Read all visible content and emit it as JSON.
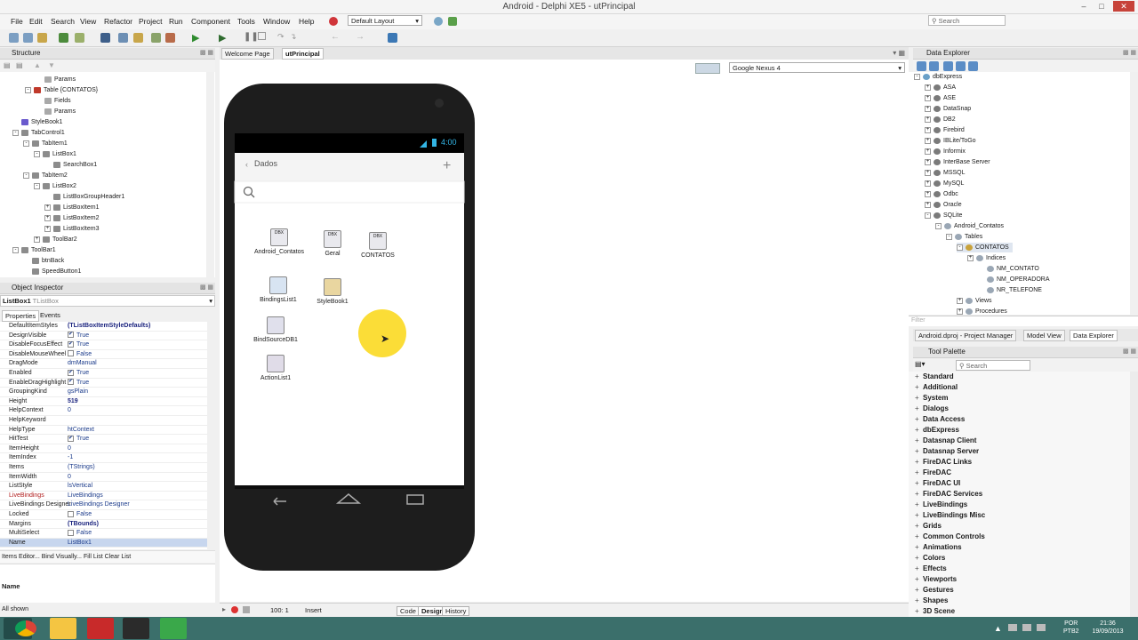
{
  "window": {
    "title": "Android - Delphi XE5 - utPrincipal",
    "search_placeholder": "Search"
  },
  "menu": [
    "File",
    "Edit",
    "Search",
    "View",
    "Refactor",
    "Project",
    "Run",
    "Component",
    "Tools",
    "Window",
    "Help"
  ],
  "layout_select": "Default Layout",
  "structure": {
    "title": "Structure",
    "rows": [
      "Params",
      "Table {CONTATOS}",
      "Fields",
      "Params",
      "StyleBook1",
      "TabControl1",
      "TabItem1",
      "ListBox1",
      "SearchBox1",
      "TabItem2",
      "ListBox2",
      "ListBoxGroupHeader1",
      "ListBoxItem1",
      "ListBoxItem2",
      "ListBoxItem3",
      "ToolBar2",
      "ToolBar1",
      "btnBack",
      "SpeedButton1"
    ]
  },
  "object_inspector": {
    "title": "Object Inspector",
    "selected": "ListBox1",
    "selected_type": "TListBox",
    "tabs": [
      "Properties",
      "Events"
    ],
    "props": [
      {
        "n": "DefaultItemStyles",
        "v": "(TListBoxItemStyleDefaults)",
        "bold": true
      },
      {
        "n": "DesignVisible",
        "v": "True",
        "chk": true
      },
      {
        "n": "DisableFocusEffect",
        "v": "True",
        "chk": true
      },
      {
        "n": "DisableMouseWheel",
        "v": "False",
        "chk": false
      },
      {
        "n": "DragMode",
        "v": "dmManual"
      },
      {
        "n": "Enabled",
        "v": "True",
        "chk": true
      },
      {
        "n": "EnableDragHighlight",
        "v": "True",
        "chk": true
      },
      {
        "n": "GroupingKind",
        "v": "gsPlain"
      },
      {
        "n": "Height",
        "v": "519",
        "bold": true
      },
      {
        "n": "HelpContext",
        "v": "0"
      },
      {
        "n": "HelpKeyword",
        "v": ""
      },
      {
        "n": "HelpType",
        "v": "htContext"
      },
      {
        "n": "HitTest",
        "v": "True",
        "chk": true
      },
      {
        "n": "ItemHeight",
        "v": "0"
      },
      {
        "n": "ItemIndex",
        "v": "-1"
      },
      {
        "n": "Items",
        "v": "(TStrings)"
      },
      {
        "n": "ItemWidth",
        "v": "0"
      },
      {
        "n": "ListStyle",
        "v": "lsVertical"
      },
      {
        "n": "LiveBindings",
        "v": "LiveBindings",
        "red": true
      },
      {
        "n": "LiveBindings Designer",
        "v": "LiveBindings Designer"
      },
      {
        "n": "Locked",
        "v": "False",
        "chk": false
      },
      {
        "n": "Margins",
        "v": "(TBounds)",
        "bold": true
      },
      {
        "n": "MultiSelect",
        "v": "False",
        "chk": false
      },
      {
        "n": "Name",
        "v": "ListBox1"
      }
    ],
    "footer_links": "Items Editor... Bind Visually... Fill List Clear List",
    "desc_title": "Name",
    "status": "All shown"
  },
  "tabs": [
    "Welcome Page",
    "utPrincipal"
  ],
  "device_select": "Google Nexus 4",
  "phone": {
    "time": "4:00",
    "header": "Dados"
  },
  "components": [
    {
      "label": "Android_Contatos",
      "glyph": "DBX"
    },
    {
      "label": "Geral",
      "glyph": "DBX"
    },
    {
      "label": "CONTATOS",
      "glyph": "DBX"
    },
    {
      "label": "BindingsList1",
      "glyph": ""
    },
    {
      "label": "StyleBook1",
      "glyph": ""
    },
    {
      "label": "BindSourceDB1",
      "glyph": ""
    },
    {
      "label": "ActionList1",
      "glyph": ""
    }
  ],
  "status": {
    "pos": "100: 1",
    "mode": "Insert",
    "tabs": [
      "Code",
      "Design",
      "History"
    ]
  },
  "data_explorer": {
    "title": "Data Explorer",
    "rows": [
      "dbExpress",
      "ASA",
      "ASE",
      "DataSnap",
      "DB2",
      "Firebird",
      "IBLite/ToGo",
      "Informix",
      "InterBase Server",
      "MSSQL",
      "MySQL",
      "Odbc",
      "Oracle",
      "SQLite",
      "Android_Contatos",
      "Tables",
      "CONTATOS",
      "Indices",
      "NM_CONTATO",
      "NM_OPERADORA",
      "NR_TELEFONE",
      "Views",
      "Procedures"
    ],
    "filter": "Filter",
    "tabs": [
      "Android.dproj - Project Manager",
      "Model View",
      "Data Explorer"
    ]
  },
  "palette": {
    "title": "Tool Palette",
    "search_placeholder": "Search",
    "items": [
      "Standard",
      "Additional",
      "System",
      "Dialogs",
      "Data Access",
      "dbExpress",
      "Datasnap Client",
      "Datasnap Server",
      "FireDAC Links",
      "FireDAC",
      "FireDAC UI",
      "FireDAC Services",
      "LiveBindings",
      "LiveBindings Misc",
      "Grids",
      "Common Controls",
      "Animations",
      "Colors",
      "Effects",
      "Viewports",
      "Gestures",
      "Shapes",
      "3D Scene"
    ]
  },
  "tray": {
    "lang": "POR",
    "kbd": "PTB2",
    "time": "21:36",
    "date": "19/09/2013"
  }
}
